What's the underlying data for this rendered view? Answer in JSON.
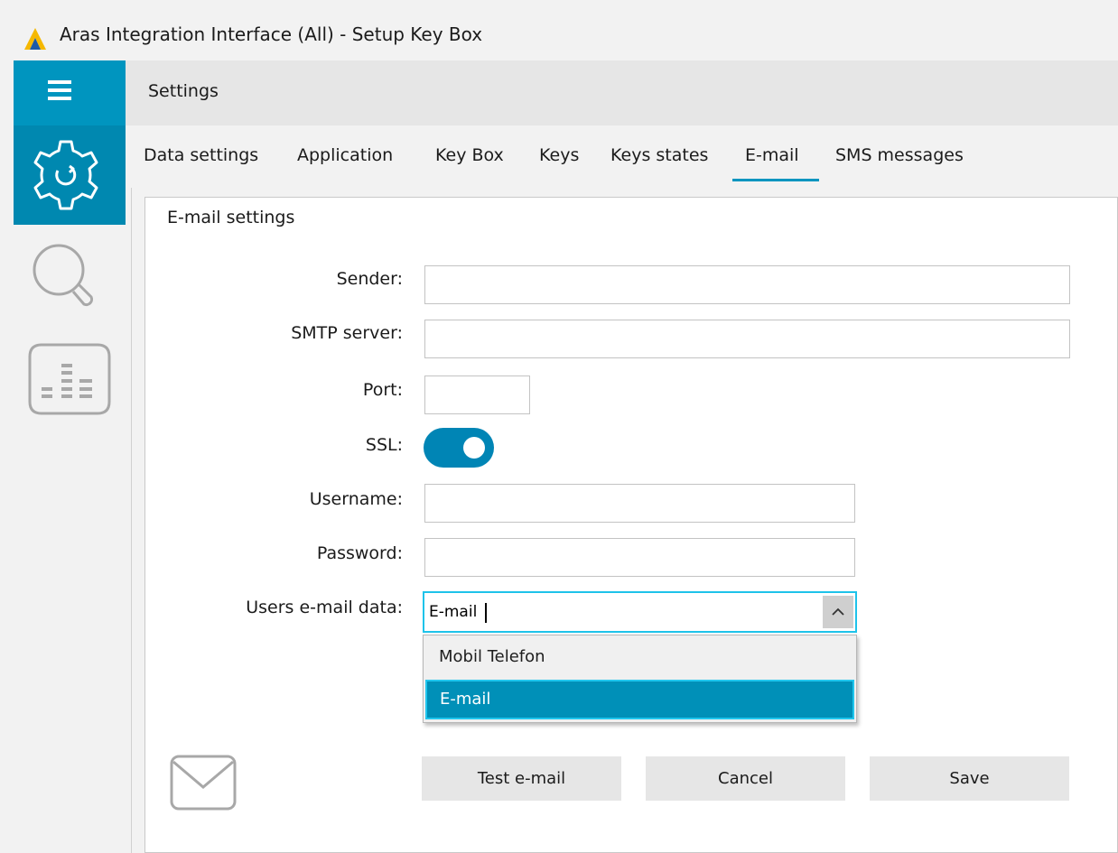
{
  "window": {
    "title": "Aras Integration Interface (All) - Setup Key Box",
    "logo_icon": "aras-logo-icon"
  },
  "sidebar": {
    "menu_icon": "hamburger-icon",
    "items": [
      {
        "icon": "gear-icon",
        "active": true
      },
      {
        "icon": "search-icon",
        "active": false
      },
      {
        "icon": "report-list-icon",
        "active": false
      }
    ]
  },
  "header": {
    "title": "Settings"
  },
  "tabs": [
    {
      "label": "Data settings",
      "active": false
    },
    {
      "label": "Application",
      "active": false
    },
    {
      "label": "Key Box",
      "active": false
    },
    {
      "label": "Keys",
      "active": false
    },
    {
      "label": "Keys states",
      "active": false
    },
    {
      "label": "E-mail",
      "active": true
    },
    {
      "label": "SMS messages",
      "active": false
    }
  ],
  "form": {
    "title": "E-mail settings",
    "sender": {
      "label": "Sender:",
      "value": ""
    },
    "smtp_server": {
      "label": "SMTP server:",
      "value": ""
    },
    "port": {
      "label": "Port:",
      "value": ""
    },
    "ssl": {
      "label": "SSL:",
      "enabled": true
    },
    "username": {
      "label": "Username:",
      "value": ""
    },
    "password": {
      "label": "Password:",
      "value": ""
    },
    "users_email_data": {
      "label": "Users e-mail data:",
      "value": "E-mail",
      "options": [
        "Mobil Telefon",
        "E-mail"
      ],
      "selected_index": 1
    }
  },
  "buttons": {
    "test": "Test e-mail",
    "cancel": "Cancel",
    "save": "Save"
  },
  "colors": {
    "accent": "#0095bf",
    "accent_dark": "#0088b0",
    "focus": "#1ec3ea"
  }
}
